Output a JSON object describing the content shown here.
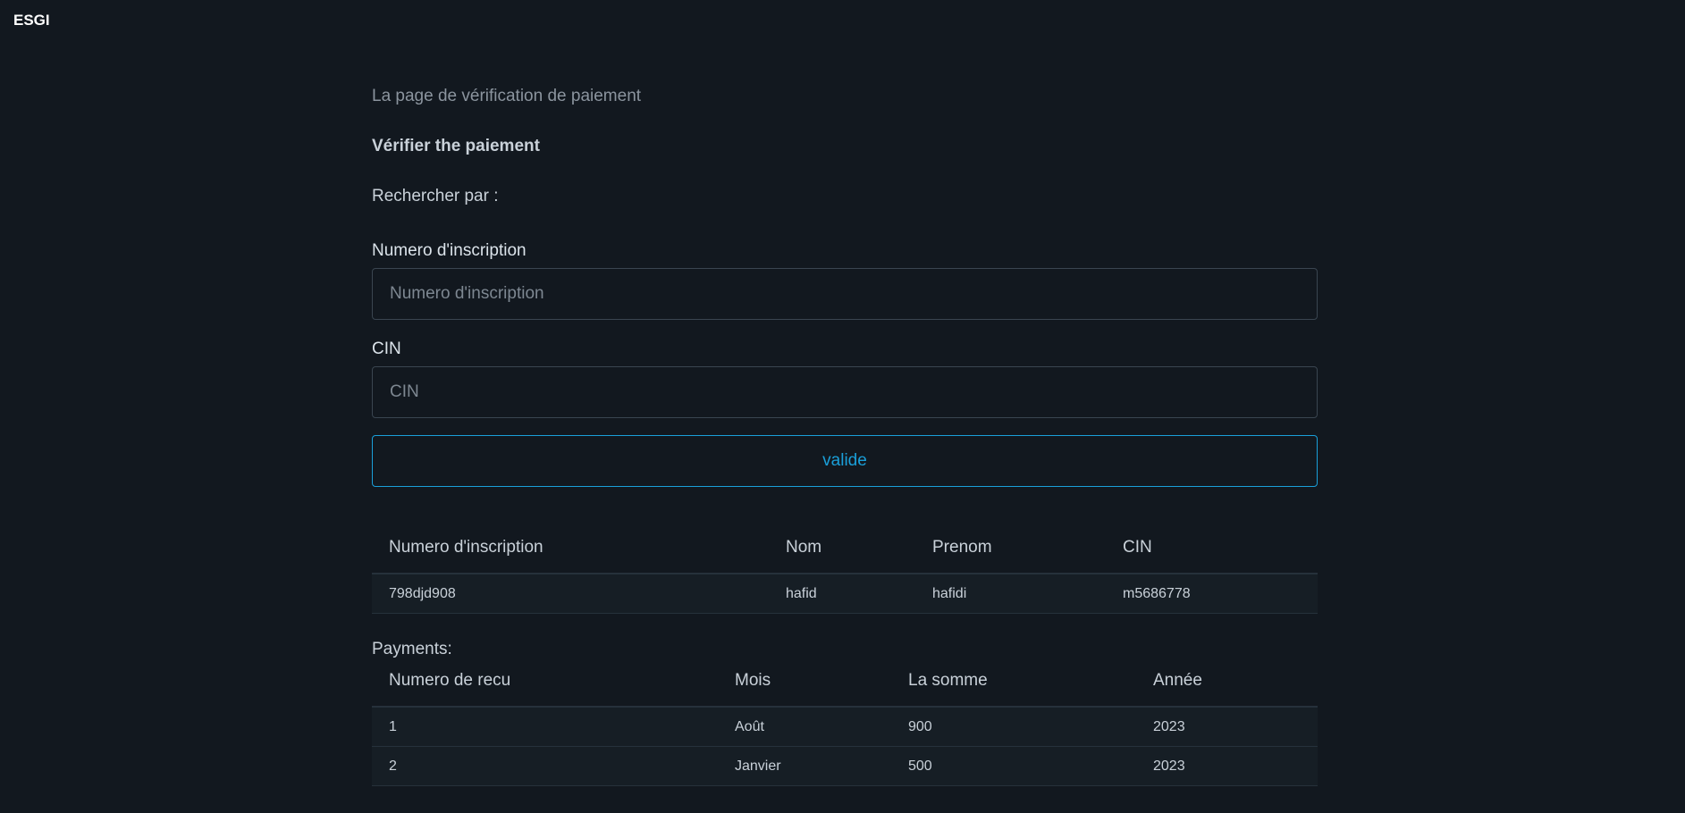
{
  "brand": "ESGI",
  "subtitle": "La page de vérification de paiement",
  "heading": "Vérifier the paiement",
  "search_by": "Rechercher par :",
  "form": {
    "inscription_label": "Numero d'inscription",
    "inscription_placeholder": "Numero d'inscription",
    "inscription_value": "",
    "cin_label": "CIN",
    "cin_placeholder": "CIN",
    "cin_value": "",
    "submit_label": "valide"
  },
  "student_table": {
    "headers": [
      "Numero d'inscription",
      "Nom",
      "Prenom",
      "CIN"
    ],
    "rows": [
      [
        "798djd908",
        "hafid",
        "hafidi",
        "m5686778"
      ]
    ]
  },
  "payments_label": "Payments:",
  "payments_table": {
    "headers": [
      "Numero de recu",
      "Mois",
      "La somme",
      "Année"
    ],
    "rows": [
      [
        "1",
        "Août",
        "900",
        "2023"
      ],
      [
        "2",
        "Janvier",
        "500",
        "2023"
      ]
    ]
  },
  "colors": {
    "background": "#12181f",
    "accent": "#1a9fd9"
  }
}
